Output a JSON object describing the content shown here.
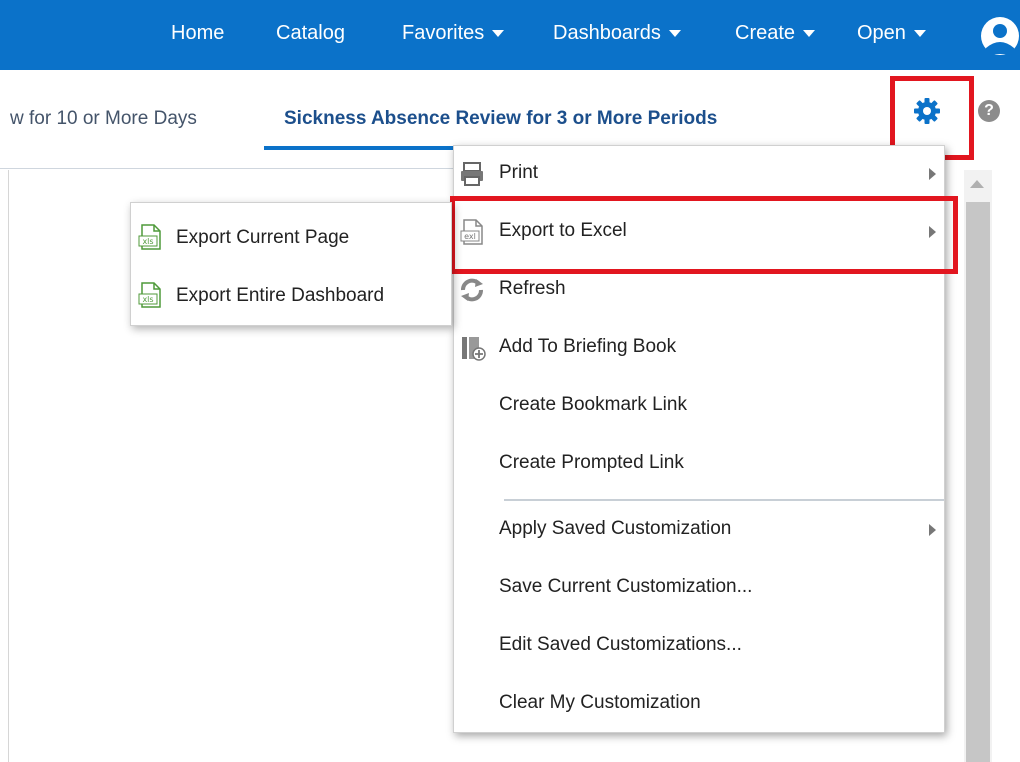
{
  "nav": {
    "items": [
      "Home",
      "Catalog",
      "Favorites",
      "Dashboards",
      "Create",
      "Open"
    ]
  },
  "tabs": {
    "previous": "w for 10 or More Days",
    "active": "Sickness Absence Review for 3 or More Periods"
  },
  "help_glyph": "?",
  "page_menu": {
    "items": [
      {
        "label": "Print",
        "icon": "printer-icon",
        "submenu": true
      },
      {
        "label": "Export to Excel",
        "icon": "excel-file-icon",
        "submenu": true
      },
      {
        "label": "Refresh",
        "icon": "refresh-icon",
        "submenu": false
      },
      {
        "label": "Add To Briefing Book",
        "icon": "briefing-book-icon",
        "submenu": false
      },
      {
        "label": "Create Bookmark Link",
        "submenu": false
      },
      {
        "label": "Create Prompted Link",
        "submenu": false
      },
      {
        "label": "Apply Saved Customization",
        "submenu": true
      },
      {
        "label": "Save Current Customization...",
        "submenu": false
      },
      {
        "label": "Edit Saved Customizations...",
        "submenu": false
      },
      {
        "label": "Clear My Customization",
        "submenu": false
      }
    ]
  },
  "export_submenu": {
    "items": [
      "Export Current Page",
      "Export Entire Dashboard"
    ],
    "icon_text": "xls"
  },
  "colors": {
    "nav_bg": "#0b72c9",
    "highlight": "#e2161f",
    "excel_green": "#4f9a3a"
  }
}
